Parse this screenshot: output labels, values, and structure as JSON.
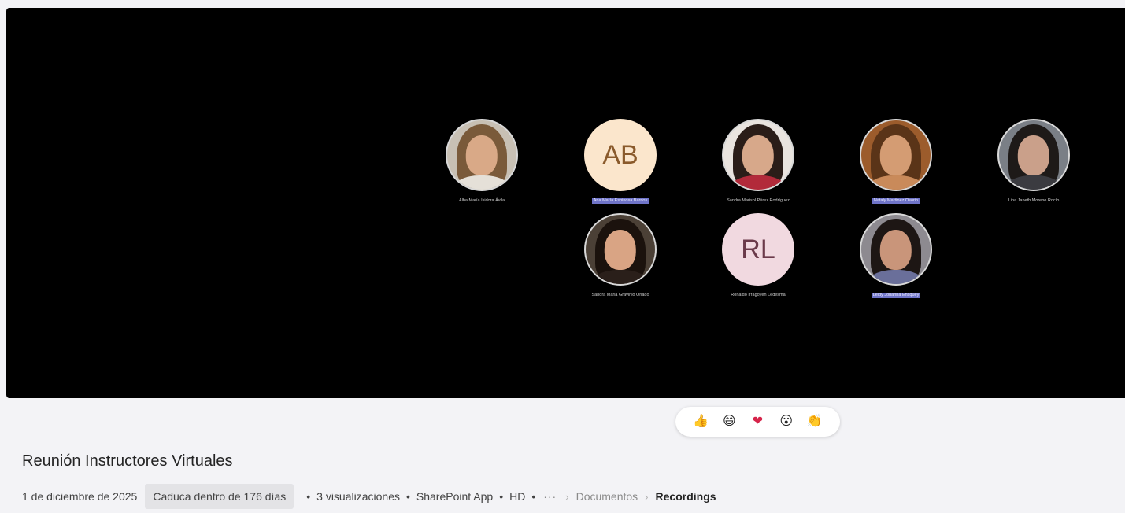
{
  "meeting": {
    "title": "Reunión Instructores Virtuales"
  },
  "participants": [
    {
      "name": "Alba María Isidora Ávila",
      "initials": "",
      "selected": false
    },
    {
      "name": "Ana María Espinosa Barrios",
      "initials": "AB",
      "selected": true
    },
    {
      "name": "Sandra Marisol Pérez Rodríguez",
      "initials": "",
      "selected": false
    },
    {
      "name": "Nataly Martínez Osorio",
      "initials": "",
      "selected": true
    },
    {
      "name": "Lina Janeth Moreno Rocío",
      "initials": "",
      "selected": false
    },
    {
      "name": "Sandra Maria Gravinio Orlado",
      "initials": "",
      "selected": false
    },
    {
      "name": "Ronaldo Irragoyen Ledesma",
      "initials": "RL",
      "selected": false
    },
    {
      "name": "Leidy Johanna Ensquey",
      "initials": "",
      "selected": true
    }
  ],
  "reactions": [
    {
      "name": "like",
      "glyph": "👍"
    },
    {
      "name": "laugh",
      "glyph": "😄"
    },
    {
      "name": "heart",
      "glyph": "❤"
    },
    {
      "name": "surprised",
      "glyph": "😮"
    },
    {
      "name": "applause",
      "glyph": "👏"
    }
  ],
  "details": {
    "date": "1 de diciembre de 2025",
    "expiry": "Caduca dentro de 176 días",
    "views": "3 visualizaciones",
    "app": "SharePoint App",
    "quality": "HD",
    "more": "···",
    "breadcrumb": [
      "Documentos",
      "Recordings"
    ]
  },
  "colors": {
    "avatar_ab_bg": "#fbe6cc",
    "avatar_ab_fg": "#8a5a2b",
    "avatar_rl_bg": "#f1d9e0",
    "avatar_rl_fg": "#6b3a4a",
    "name_highlight": "#6f74c8"
  }
}
